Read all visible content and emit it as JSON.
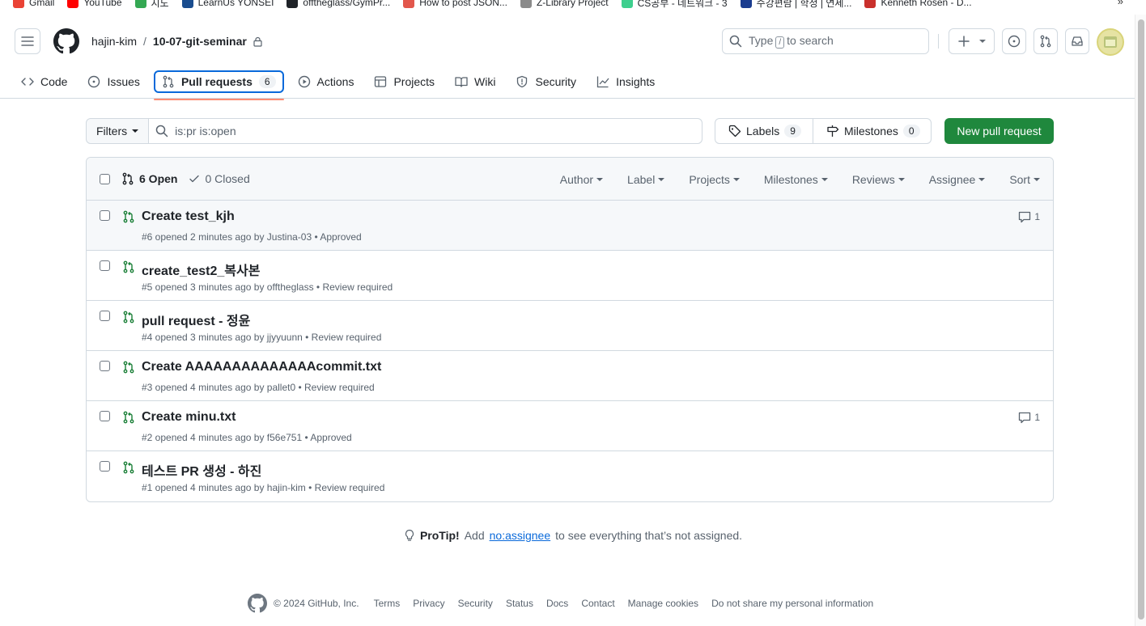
{
  "bookmarks": [
    {
      "label": "Gmail",
      "color": "#ea4335"
    },
    {
      "label": "YouTube",
      "color": "#ff0000"
    },
    {
      "label": "지도",
      "color": "#34a853"
    },
    {
      "label": "LearnUs YONSEI",
      "color": "#1a4d8f"
    },
    {
      "label": "offtheglass/GymPr...",
      "color": "#1f2328"
    },
    {
      "label": "How to post JSON...",
      "color": "#e2574c"
    },
    {
      "label": "Z-Library Project",
      "color": "#8a8a8a"
    },
    {
      "label": "CS공부 - 네트워크 - 3",
      "color": "#3ecf8e"
    },
    {
      "label": "수강편람 | 학정 | 연세...",
      "color": "#1a3c8f"
    },
    {
      "label": "Kenneth Rosen - D...",
      "color": "#c9302c"
    }
  ],
  "bookmarks_more": "»",
  "header": {
    "owner": "hajin-kim",
    "separator": "/",
    "repo": "10-07-git-seminar",
    "search_prefix": "Type",
    "search_key": "/",
    "search_suffix": "to search"
  },
  "nav": {
    "tabs": [
      {
        "label": "Code",
        "icon": "code-icon"
      },
      {
        "label": "Issues",
        "icon": "issue-opened-icon"
      },
      {
        "label": "Pull requests",
        "icon": "git-pull-request-icon",
        "count": "6",
        "selected": true
      },
      {
        "label": "Actions",
        "icon": "play-icon"
      },
      {
        "label": "Projects",
        "icon": "table-icon"
      },
      {
        "label": "Wiki",
        "icon": "book-icon"
      },
      {
        "label": "Security",
        "icon": "shield-icon"
      },
      {
        "label": "Insights",
        "icon": "graph-icon"
      }
    ]
  },
  "toolbar": {
    "filters_label": "Filters",
    "query": "is:pr is:open",
    "labels_label": "Labels",
    "labels_count": "9",
    "milestones_label": "Milestones",
    "milestones_count": "0",
    "new_pr_label": "New pull request"
  },
  "list": {
    "open_label": "6 Open",
    "closed_label": "0 Closed",
    "filters": [
      "Author",
      "Label",
      "Projects",
      "Milestones",
      "Reviews",
      "Assignee",
      "Sort"
    ],
    "items": [
      {
        "title": "Create test_kjh",
        "meta": "#6 opened 2 minutes ago by Justina-03 • Approved",
        "comments": "1"
      },
      {
        "title": "create_test2_복사본",
        "meta": "#5 opened 3 minutes ago by offtheglass • Review required",
        "comments": ""
      },
      {
        "title": "pull request - 정윤",
        "meta": "#4 opened 3 minutes ago by jjyyuunn • Review required",
        "comments": ""
      },
      {
        "title": "Create AAAAAAAAAAAAAAcommit.txt",
        "meta": "#3 opened 4 minutes ago by pallet0 • Review required",
        "comments": ""
      },
      {
        "title": "Create minu.txt",
        "meta": "#2 opened 4 minutes ago by f56e751 • Approved",
        "comments": "1"
      },
      {
        "title": "테스트 PR 생성 - 하진",
        "meta": "#1 opened 4 minutes ago by hajin-kim • Review required",
        "comments": ""
      }
    ]
  },
  "protip": {
    "strong": "ProTip!",
    "pre": "Add",
    "link": "no:assignee",
    "post": "to see everything that’s not assigned."
  },
  "footer": {
    "copyright": "© 2024 GitHub, Inc.",
    "links": [
      "Terms",
      "Privacy",
      "Security",
      "Status",
      "Docs",
      "Contact",
      "Manage cookies",
      "Do not share my personal information"
    ]
  },
  "colors": {
    "accent": "#0969da",
    "open_green": "#1a7f37",
    "primary_button": "#1f883d",
    "underline": "#fd8c73"
  }
}
